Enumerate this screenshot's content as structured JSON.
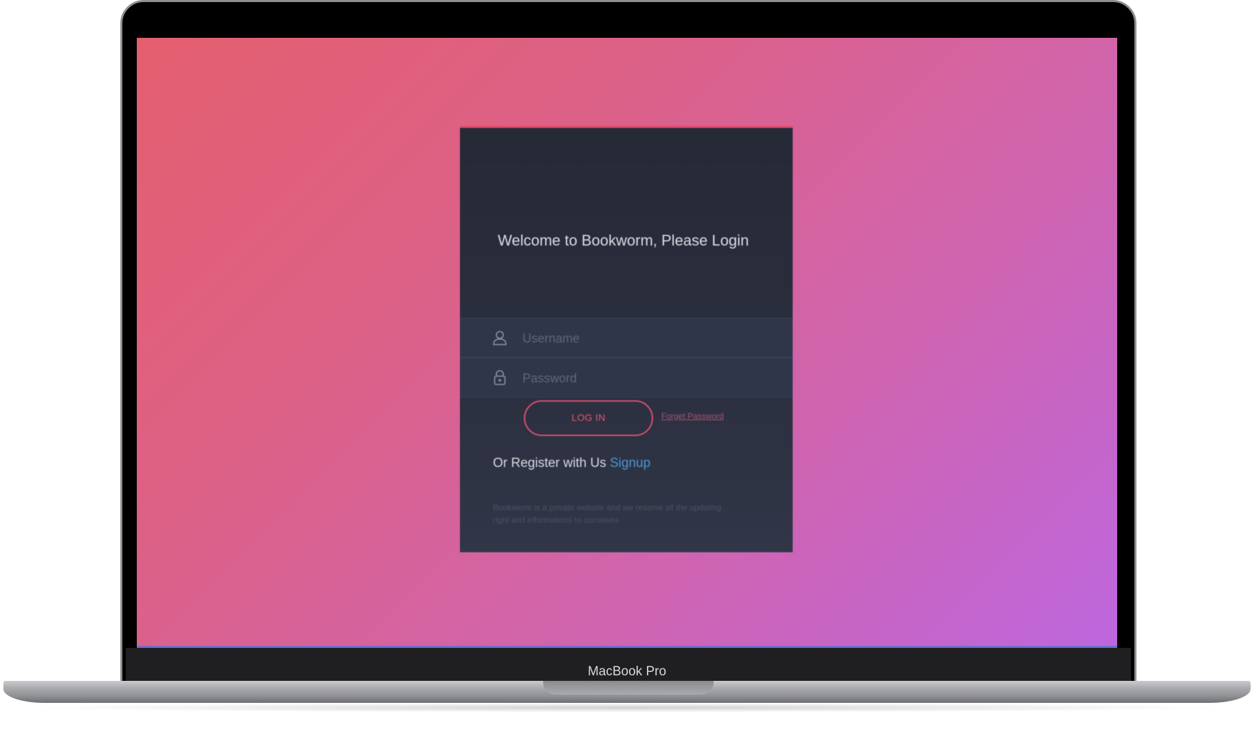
{
  "device": {
    "label": "MacBook Pro"
  },
  "login_card": {
    "title": "Welcome to Bookworm, Please Login",
    "username": {
      "placeholder": "Username",
      "value": "",
      "icon": "user-icon"
    },
    "password": {
      "placeholder": "Password",
      "value": "",
      "icon": "lock-icon"
    },
    "login_button_label": "LOG IN",
    "forgot_password_label": "Forget Password",
    "register_prefix": "Or Register with Us",
    "signup_label": "Signup",
    "disclaimer": "Bookworm is a private website and we reserve all the updating right and informations to ourselves"
  },
  "colors": {
    "background_gradient_start": "#e45f6e",
    "background_gradient_end": "#bd66de",
    "card_background": "#2b2f3e",
    "accent": "#e24a6a",
    "link": "#4a95d6"
  }
}
